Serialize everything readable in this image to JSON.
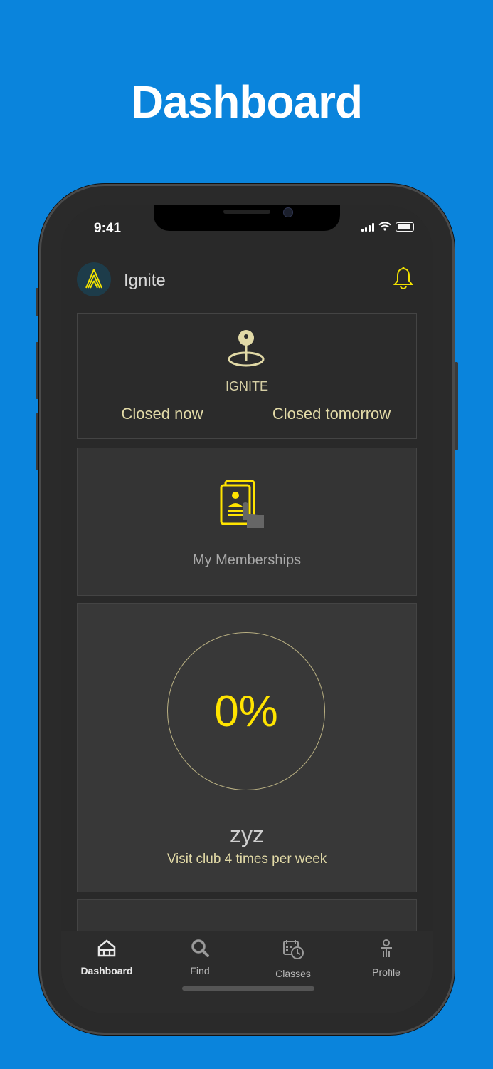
{
  "page": {
    "headline": "Dashboard"
  },
  "status_bar": {
    "time": "9:41"
  },
  "header": {
    "app_name": "Ignite",
    "logo_icon": "ignite-logo-icon",
    "notification_icon": "bell-icon"
  },
  "location_card": {
    "icon": "location-pin-icon",
    "club_name": "IGNITE",
    "status_today": "Closed now",
    "status_tomorrow": "Closed tomorrow"
  },
  "memberships_card": {
    "icon": "membership-card-icon",
    "label": "My Memberships"
  },
  "goal_card": {
    "progress_text": "0%",
    "progress_value": 0,
    "goal_name": "zyz",
    "goal_description": "Visit club 4 times per week"
  },
  "tabbar": {
    "tabs": [
      {
        "label": "Dashboard",
        "icon": "home-icon",
        "active": true
      },
      {
        "label": "Find",
        "icon": "search-icon",
        "active": false
      },
      {
        "label": "Classes",
        "icon": "calendar-clock-icon",
        "active": false
      },
      {
        "label": "Profile",
        "icon": "person-icon",
        "active": false
      }
    ]
  },
  "colors": {
    "background": "#0a84dc",
    "accent": "#ffe400",
    "muted_accent": "#e1d9a6",
    "screen": "#292929"
  }
}
